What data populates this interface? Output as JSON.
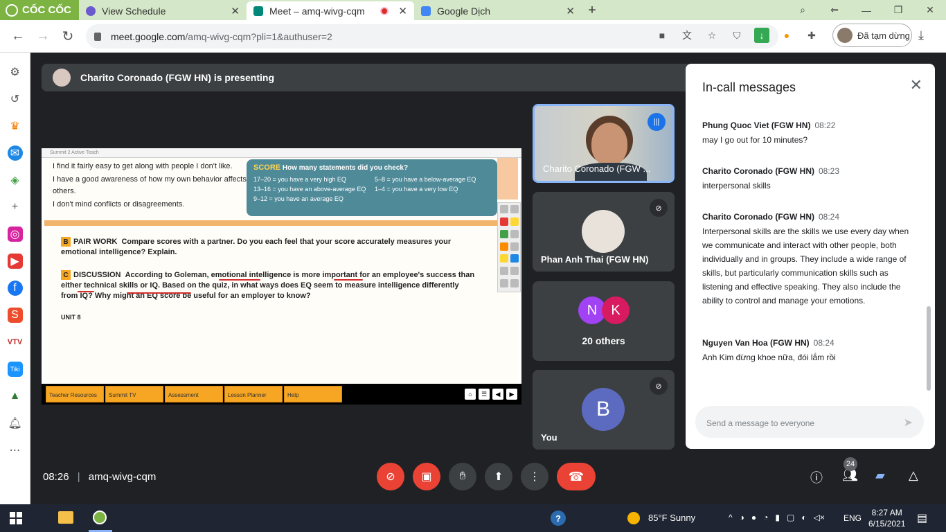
{
  "browser": {
    "brand": "CỐC CỐC",
    "tabs": [
      {
        "title": "View Schedule",
        "icon": "schedule-icon",
        "active": false
      },
      {
        "title": "Meet – amq-wivg-cqm",
        "icon": "meet-icon",
        "active": true
      },
      {
        "title": "Google Dịch",
        "icon": "translate-icon",
        "active": false
      }
    ],
    "url_domain": "meet.google.com",
    "url_path": "/amq-wivg-cqm?pli=1&authuser=2",
    "profile_status": "Đã tạm dừng"
  },
  "meet": {
    "presenter_banner": "Charito Coronado (FGW HN) is presenting",
    "slide": {
      "window_title": "Summit 2 Active Teach",
      "statements": [
        "I find it fairly easy to get along with people I don't like.",
        "I have a good awareness of how my own behavior affects others.",
        "I don't mind conflicts or disagreements."
      ],
      "score_label": "SCORE",
      "score_title": "How many statements did you check?",
      "score_rows": [
        [
          "17–20 = you have a very high EQ",
          "5–8 = you have a below-average EQ"
        ],
        [
          "13–16 = you have an above-average EQ",
          "1–4 = you have a very low EQ"
        ],
        [
          "9–12 = you have an average EQ",
          ""
        ]
      ],
      "pair_letter": "B",
      "pair_label": "PAIR WORK",
      "pair_text": "Compare scores with a partner. Do you each feel that your score accurately measures your emotional intelligence? Explain.",
      "disc_letter": "C",
      "disc_label": "DISCUSSION",
      "disc_text": "According to Goleman, emotional intelligence is more important for an employee's success than either technical skills or IQ. Based on the quiz, in what ways does EQ seem to measure intelligence differently from IQ? Why might an EQ score be useful for an employer to know?",
      "unit": "UNIT 8",
      "tabs": [
        "Teacher Resources",
        "Summit TV",
        "Assessment",
        "Lesson Planner",
        "Help"
      ]
    },
    "tiles": {
      "presenter_name": "Charito Coronado (FGW ...",
      "p2_name": "Phan Anh Thai (FGW HN)",
      "others_initials": [
        "N",
        "K"
      ],
      "others_label": "20 others",
      "me_initial": "B",
      "me_label": "You"
    },
    "chat": {
      "title": "In-call messages",
      "messages": [
        {
          "sender": "Phung Quoc Viet (FGW HN)",
          "time": "08:22",
          "text": "may I go out for 10 minutes?"
        },
        {
          "sender": "Charito Coronado (FGW HN)",
          "time": "08:23",
          "text": "interpersonal skills"
        },
        {
          "sender": "Charito Coronado (FGW HN)",
          "time": "08:24",
          "text": "Interpersonal skills are the skills we use every day when we communicate and interact with other people, both individually and in groups. They include a wide range of skills, but particularly communication skills such as listening and effective speaking. They also include the ability to control and manage your emotions."
        },
        {
          "sender": "Nguyen Van Hoa (FGW HN)",
          "time": "08:24",
          "text": "Anh Kim đừng khoe nữa, đói lắm rồi"
        }
      ],
      "placeholder": "Send a message to everyone"
    },
    "bottom": {
      "time": "08:26",
      "meeting_code": "amq-wivg-cqm",
      "participants_badge": "24"
    }
  },
  "taskbar": {
    "weather": "85°F  Sunny",
    "lang": "ENG",
    "time": "8:27 AM",
    "date": "6/15/2021"
  },
  "colors": {
    "meet_bg": "#202124",
    "end_call": "#ea4335",
    "accent_blue": "#1a73e8"
  }
}
